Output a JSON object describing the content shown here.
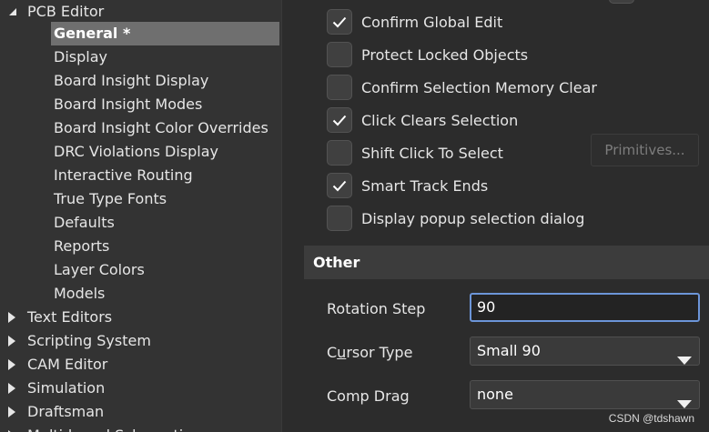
{
  "tree": {
    "root": {
      "label": "PCB Editor",
      "expanded": true
    },
    "children": [
      "General *",
      "Display",
      "Board Insight Display",
      "Board Insight Modes",
      "Board Insight Color Overrides",
      "DRC Violations Display",
      "Interactive Routing",
      "True Type Fonts",
      "Defaults",
      "Reports",
      "Layer Colors",
      "Models"
    ],
    "selected_index": 0,
    "collapsed_roots": [
      "Text Editors",
      "Scripting System",
      "CAM Editor",
      "Simulation",
      "Draftsman",
      "Multi-board Schematic"
    ]
  },
  "options": [
    {
      "label": "Confirm Global Edit",
      "checked": true
    },
    {
      "label": "Protect Locked Objects",
      "checked": false
    },
    {
      "label": "Confirm Selection Memory Clear",
      "checked": false
    },
    {
      "label": "Click Clears Selection",
      "checked": true
    },
    {
      "label": "Shift Click To Select",
      "checked": false
    },
    {
      "label": "Smart Track Ends",
      "checked": true
    },
    {
      "label": "Display popup selection dialog",
      "checked": false
    }
  ],
  "primitives_button": "Primitives...",
  "other": {
    "header": "Other",
    "rotation_step": {
      "label": "Rotation Step",
      "value": "90"
    },
    "cursor_type": {
      "label_pre": "C",
      "label_u": "u",
      "label_post": "rsor Type",
      "value": "Small 90"
    },
    "comp_drag": {
      "label": "Comp Drag",
      "value": "none"
    }
  },
  "watermark": "CSDN @tdshawn",
  "colors": {
    "selection": "#6f6f6f",
    "focus_border": "#6c95d8",
    "check": "#ffffff"
  }
}
